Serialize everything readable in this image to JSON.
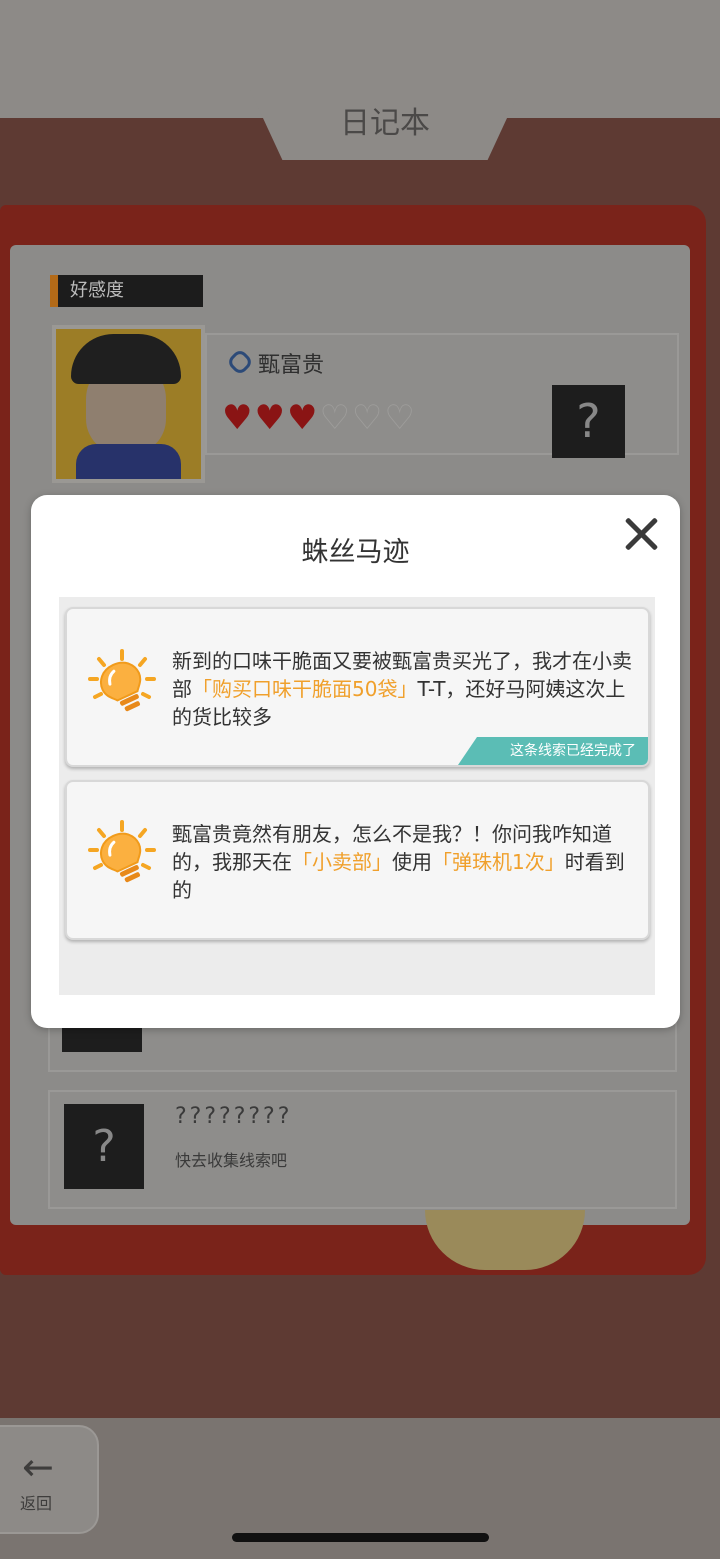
{
  "notebook": {
    "title": "日记本",
    "tag": "好感度",
    "character_name": "甄富贵",
    "hearts_full": "♥♥♥",
    "hearts_empty": "♡♡♡",
    "mystery_mark": "?",
    "hidden_name": "????????",
    "hidden_hint": "快去收集线索吧"
  },
  "back_button": {
    "label": "返回"
  },
  "modal": {
    "title": "蛛丝马迹",
    "clues": [
      {
        "text_part1": "新到的口味干脆面又要被甄富贵买光了，我才在小卖部",
        "highlight1": "「购买口味干脆面50袋」",
        "text_part2": "T-T，还好马阿姨这次上的货比较多",
        "status": "这条线索已经完成了"
      },
      {
        "text_part1": "甄富贵竟然有朋友，怎么不是我？！你问我咋知道的，我那天在",
        "highlight1": "「小卖部」",
        "text_part2": "使用",
        "highlight2": "「弹珠机1次」",
        "text_part3": "时看到的"
      }
    ]
  },
  "colors": {
    "accent": "#f0a02c",
    "done_ribbon": "#5bbdb5"
  }
}
